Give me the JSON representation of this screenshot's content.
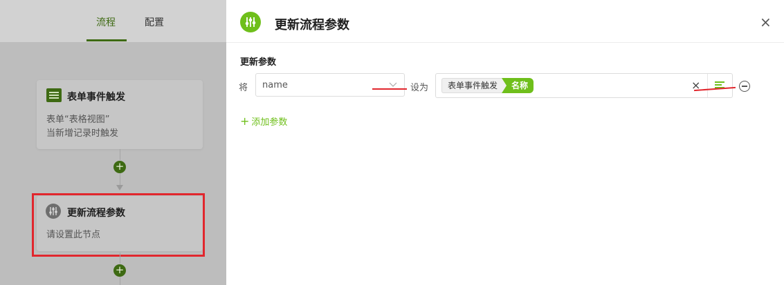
{
  "left": {
    "tabs": [
      {
        "label": "流程",
        "active": true
      },
      {
        "label": "配置",
        "active": false
      }
    ],
    "trigger_card": {
      "title": "表单事件触发",
      "line1": "表单“表格视图”",
      "line2": "当新增记录时触发"
    },
    "update_card": {
      "title": "更新流程参数",
      "line1": "请设置此节点"
    },
    "add_node_symbol": "+"
  },
  "panel": {
    "title": "更新流程参数",
    "close_symbol": "×",
    "section_label": "更新参数",
    "row": {
      "prefix": "将",
      "param_value": "name",
      "middle": "设为",
      "chip_source": "表单事件触发",
      "chip_field": "名称",
      "clear_symbol": "×"
    },
    "add_param_label": "添加参数",
    "add_param_symbol": "+"
  },
  "colors": {
    "accent": "#6fbf1b",
    "dim_accent": "#3e6a13",
    "highlight_red": "#e1262d"
  },
  "icons": [
    "sliders-icon",
    "table-icon",
    "close-icon",
    "chevron-down-icon",
    "insert-field-icon",
    "remove-circle-icon",
    "plus-icon"
  ]
}
